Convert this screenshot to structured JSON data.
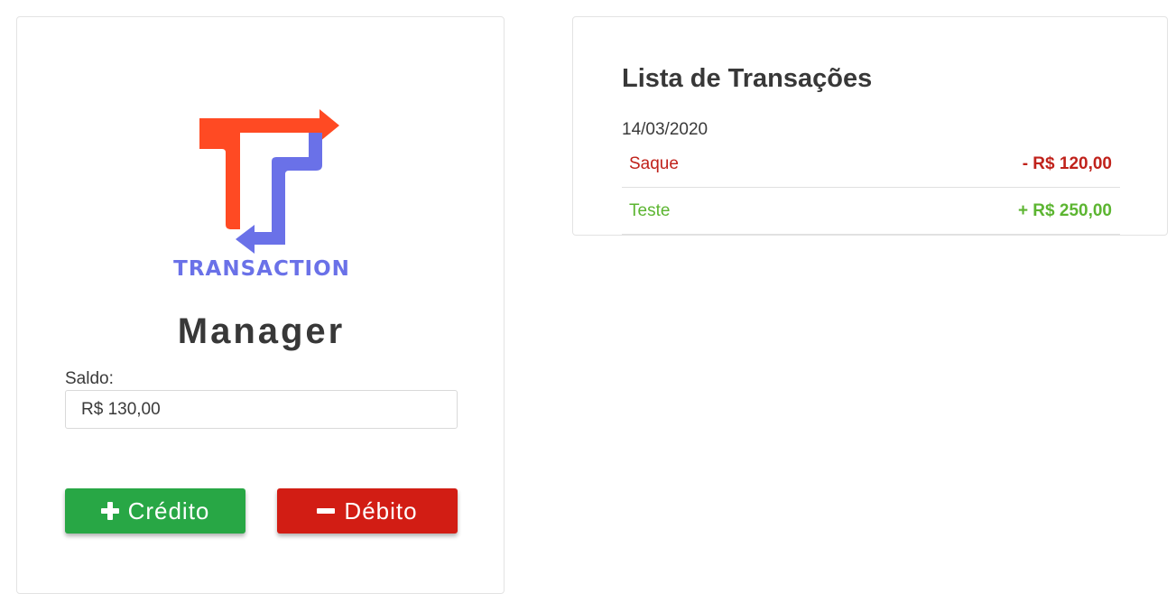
{
  "brand": {
    "logo_text": "TRANSACTION",
    "title": "Manager",
    "colors": {
      "logo_red": "#ff4a23",
      "logo_blue": "#6a71e8"
    }
  },
  "balance": {
    "label": "Saldo:",
    "value": "R$ 130,00"
  },
  "actions": {
    "credit": {
      "label": "Crédito",
      "icon": "plus-icon",
      "color": "#28a745"
    },
    "debit": {
      "label": "Débito",
      "icon": "minus-icon",
      "color": "#d21d14"
    }
  },
  "transactions": {
    "title": "Lista de Transações",
    "groups": [
      {
        "date": "14/03/2020",
        "items": [
          {
            "description": "Saque",
            "amount": "- R$ 120,00",
            "type": "debit"
          },
          {
            "description": "Teste",
            "amount": "+ R$ 250,00",
            "type": "credit"
          }
        ]
      }
    ]
  }
}
